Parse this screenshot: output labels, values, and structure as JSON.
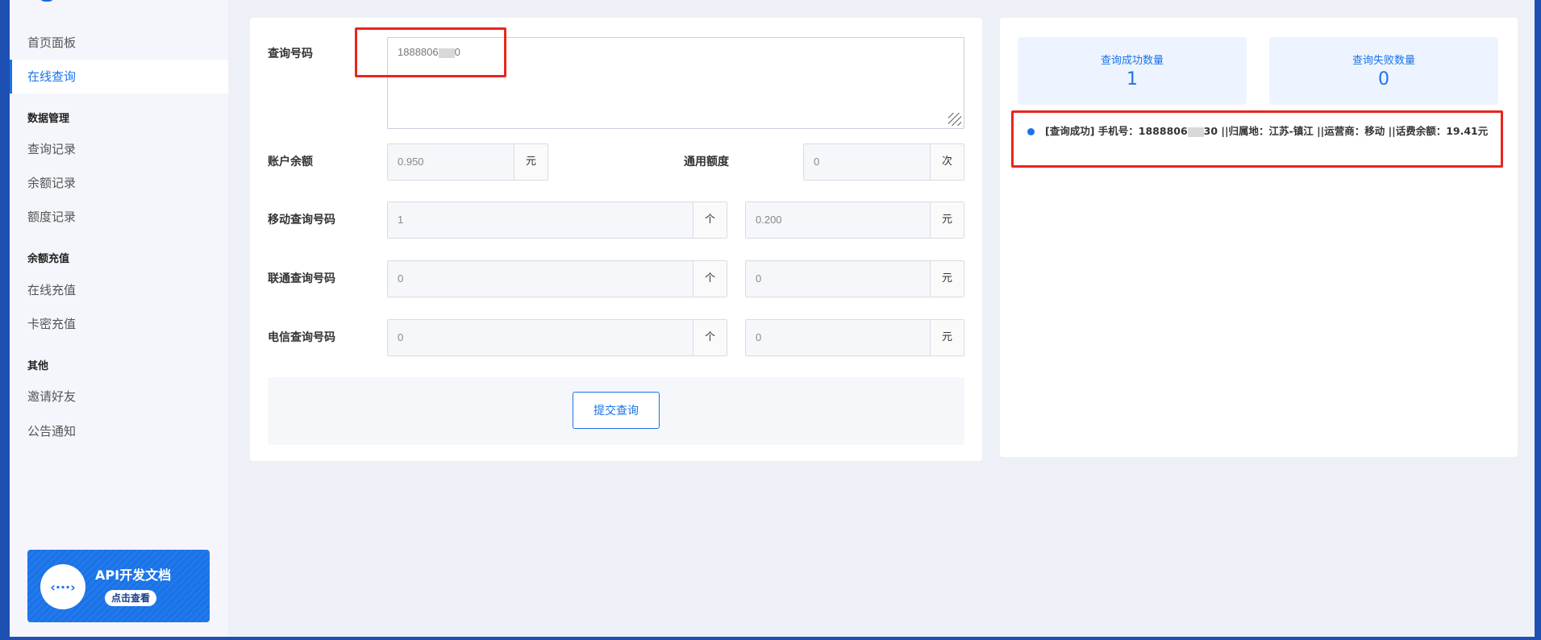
{
  "sidebar": {
    "items": [
      {
        "label": "首页面板"
      },
      {
        "label": "在线查询"
      }
    ],
    "groups": [
      {
        "title": "数据管理",
        "items": [
          {
            "label": "查询记录"
          },
          {
            "label": "余额记录"
          },
          {
            "label": "额度记录"
          }
        ]
      },
      {
        "title": "余额充值",
        "items": [
          {
            "label": "在线充值"
          },
          {
            "label": "卡密充值"
          }
        ]
      },
      {
        "title": "其他",
        "items": [
          {
            "label": "邀请好友"
          },
          {
            "label": "公告通知"
          }
        ]
      }
    ],
    "api_card": {
      "icon": "‹···›",
      "title": "API开发文档",
      "button": "点击查看"
    }
  },
  "form": {
    "query_number_label": "查询号码",
    "query_number_value": "1888806",
    "query_number_value_end": "0",
    "balance_label": "账户余额",
    "balance_value": "0.950",
    "balance_unit": "元",
    "quota_label": "通用额度",
    "quota_value": "0",
    "quota_unit": "次",
    "mobile_label": "移动查询号码",
    "mobile_count": "1",
    "mobile_count_unit": "个",
    "mobile_cost": "0.200",
    "mobile_cost_unit": "元",
    "unicom_label": "联通查询号码",
    "unicom_count": "0",
    "unicom_count_unit": "个",
    "unicom_cost": "0",
    "unicom_cost_unit": "元",
    "telecom_label": "电信查询号码",
    "telecom_count": "0",
    "telecom_count_unit": "个",
    "telecom_cost": "0",
    "telecom_cost_unit": "元",
    "submit_label": "提交查询"
  },
  "stats": {
    "success_label": "查询成功数量",
    "success_value": "1",
    "fail_label": "查询失败数量",
    "fail_value": "0"
  },
  "results": [
    {
      "text_start": "[查询成功] 手机号：1888806",
      "text_end": "30 ||归属地：江苏-镇江 ||运营商：移动 ||话费余额：19.41元"
    }
  ],
  "colors": {
    "accent": "#1a73e8",
    "frame": "#1e4fb3",
    "highlight": "#e8261f"
  }
}
